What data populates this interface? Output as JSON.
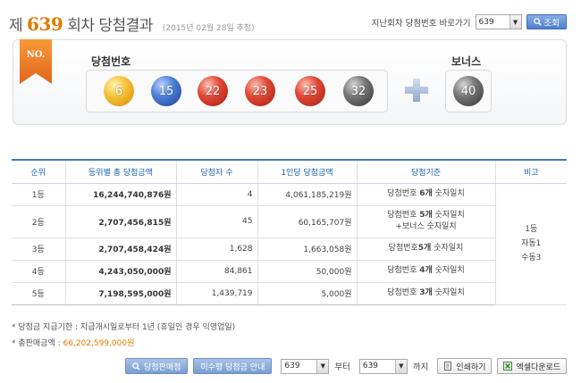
{
  "header": {
    "prefix": "제",
    "round": "639",
    "suffix": "회차 당첨결과",
    "date": "(2015년 02월 28일 추첨)",
    "jump_label": "지난회차 당첨번호 바로가기",
    "jump_value": "639",
    "search_label": "조회"
  },
  "result": {
    "ribbon": "NO.",
    "win_label": "당첨번호",
    "bonus_label": "보너스",
    "numbers": [
      "6",
      "15",
      "22",
      "23",
      "25",
      "32"
    ],
    "ball_colors": [
      "#f7c33a",
      "#4f7fd8",
      "#e24a38",
      "#e24a38",
      "#e24a38",
      "#777777"
    ],
    "bonus": "40",
    "bonus_color": "#777777"
  },
  "table": {
    "headers": [
      "순위",
      "등위별 총 당첨금액",
      "당첨자 수",
      "1인당 당첨금액",
      "당첨기준",
      "비고"
    ],
    "rows": [
      {
        "rank": "1등",
        "total": "16,244,740,876원",
        "winners": "4",
        "per": "4,061,185,219원",
        "crit_a": "당첨번호 ",
        "crit_b": "6개",
        "crit_c": " 숫자일치",
        "crit2": ""
      },
      {
        "rank": "2등",
        "total": "2,707,456,815원",
        "winners": "45",
        "per": "60,165,707원",
        "crit_a": "당첨번호 ",
        "crit_b": "5개",
        "crit_c": " 숫자일치",
        "crit2": "+보너스 숫자일치"
      },
      {
        "rank": "3등",
        "total": "2,707,458,424원",
        "winners": "1,628",
        "per": "1,663,058원",
        "crit_a": "당첨번호",
        "crit_b": "5개",
        "crit_c": " 숫자일치",
        "crit2": ""
      },
      {
        "rank": "4등",
        "total": "4,243,050,000원",
        "winners": "84,861",
        "per": "50,000원",
        "crit_a": "당첨번호 ",
        "crit_b": "4개",
        "crit_c": " 숫자일치",
        "crit2": ""
      },
      {
        "rank": "5등",
        "total": "7,198,595,000원",
        "winners": "1,439,719",
        "per": "5,000원",
        "crit_a": "당첨번호 ",
        "crit_b": "3개",
        "crit_c": " 숫자일치",
        "crit2": ""
      }
    ],
    "remark": [
      "1등",
      "자동1",
      "수동3"
    ]
  },
  "notes": {
    "line1": "* 당첨금 지급기한 : 지급개시일로부터 1년 (휴일인 경우 익영업일)",
    "line2_label": "* 총판매금액 : ",
    "line2_value": "66,202,599,000원"
  },
  "bottom": {
    "shops_label": "당첨판매점",
    "unclaimed_label": "미수령 당첨금 안내",
    "from_value": "639",
    "from_text": "부터",
    "to_value": "639",
    "to_text": "까지",
    "print_label": "인쇄하기",
    "excel_label": "엑셀다운로드"
  }
}
